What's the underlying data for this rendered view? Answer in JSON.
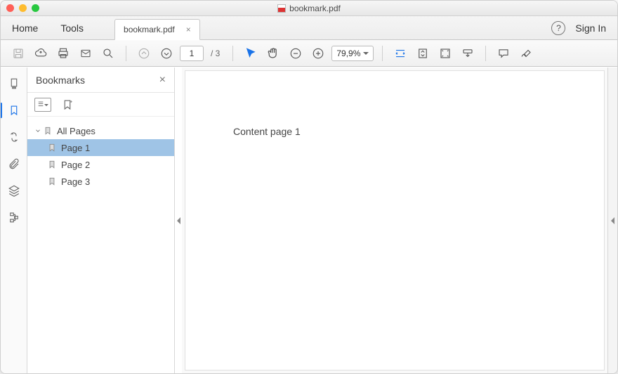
{
  "window": {
    "title": "bookmark.pdf"
  },
  "tabs": {
    "home": "Home",
    "tools": "Tools",
    "file": {
      "label": "bookmark.pdf"
    }
  },
  "topright": {
    "signin": "Sign In"
  },
  "toolbar": {
    "page_current": "1",
    "page_total": "/ 3",
    "zoom": "79,9%"
  },
  "panel": {
    "title": "Bookmarks",
    "root": "All Pages",
    "items": [
      {
        "label": "Page 1",
        "selected": true
      },
      {
        "label": "Page 2",
        "selected": false
      },
      {
        "label": "Page 3",
        "selected": false
      }
    ]
  },
  "document": {
    "content": "Content page 1"
  }
}
